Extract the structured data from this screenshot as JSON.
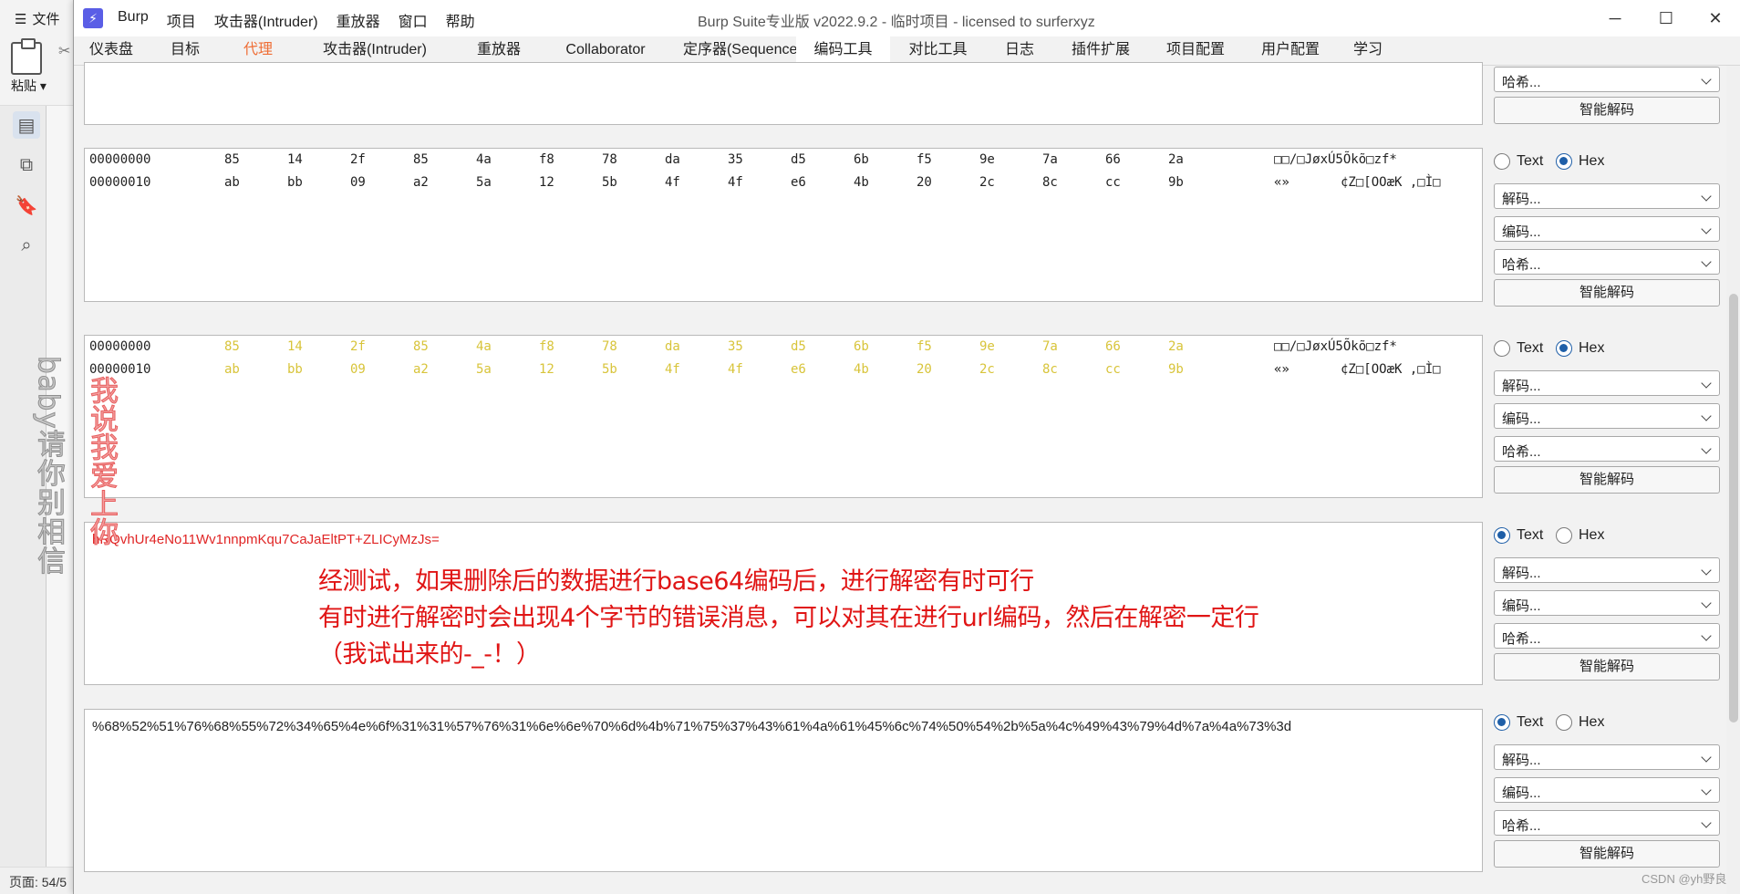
{
  "background_app": {
    "file_menu": "文件",
    "paste_label": "粘贴",
    "page_status": "页面: 54/5",
    "watermark_gray": "baby请你别相信",
    "watermark_red": "我说我爱上你"
  },
  "window": {
    "logo": "⚡",
    "title": "Burp Suite专业版  v2022.9.2 - 临时项目 - licensed to surferxyz",
    "menu": [
      "Burp",
      "项目",
      "攻击器(Intruder)",
      "重放器",
      "窗口",
      "帮助"
    ]
  },
  "tabs": [
    "仪表盘",
    "目标",
    "代理",
    "攻击器(Intruder)",
    "重放器",
    "Collaborator",
    "定序器(Sequencer)",
    "编码工具",
    "对比工具",
    "日志",
    "插件扩展",
    "项目配置",
    "用户配置",
    "学习"
  ],
  "active_tab": "编码工具",
  "accent_color": "#ef6e36",
  "labels": {
    "text": "Text",
    "hex": "Hex",
    "decode": "解码...",
    "encode": "编码...",
    "hash": "哈希...",
    "smart_decode": "智能解码"
  },
  "hex": {
    "row1_offset": "00000000",
    "row1_bytes": [
      "85",
      "14",
      "2f",
      "85",
      "4a",
      "f8",
      "78",
      "da",
      "35",
      "d5",
      "6b",
      "f5",
      "9e",
      "7a",
      "66",
      "2a"
    ],
    "row1_ascii": "□□/□JøxÚ5Õkõ□zf*",
    "row2_offset": "00000010",
    "row2_bytes": [
      "ab",
      "bb",
      "09",
      "a2",
      "5a",
      "12",
      "5b",
      "4f",
      "4f",
      "e6",
      "4b",
      "20",
      "2c",
      "8c",
      "cc",
      "9b"
    ],
    "row2_ascii_a": "«»",
    "row2_ascii_b": "¢Z□[OOæK ,□Ì□"
  },
  "panel4": {
    "text": "hRQvhUr4eNo11Wv1nnpmKqu7CaJaEltPT+ZLICyMzJs=",
    "annotation1": "经测试，如果删除后的数据进行base64编码后，进行解密有时可行",
    "annotation2": "有时进行解密时会出现4个字节的错误消息，可以对其在进行url编码，然后在解密一定行",
    "annotation3": "（我试出来的-_-！）"
  },
  "panel5": {
    "text": "%68%52%51%76%68%55%72%34%65%4e%6f%31%31%57%76%31%6e%6e%70%6d%4b%71%75%37%43%61%4a%61%45%6c%74%50%54%2b%5a%4c%49%43%79%4d%7a%4a%73%3d"
  },
  "watermark_csdn": "CSDN @yh野良"
}
